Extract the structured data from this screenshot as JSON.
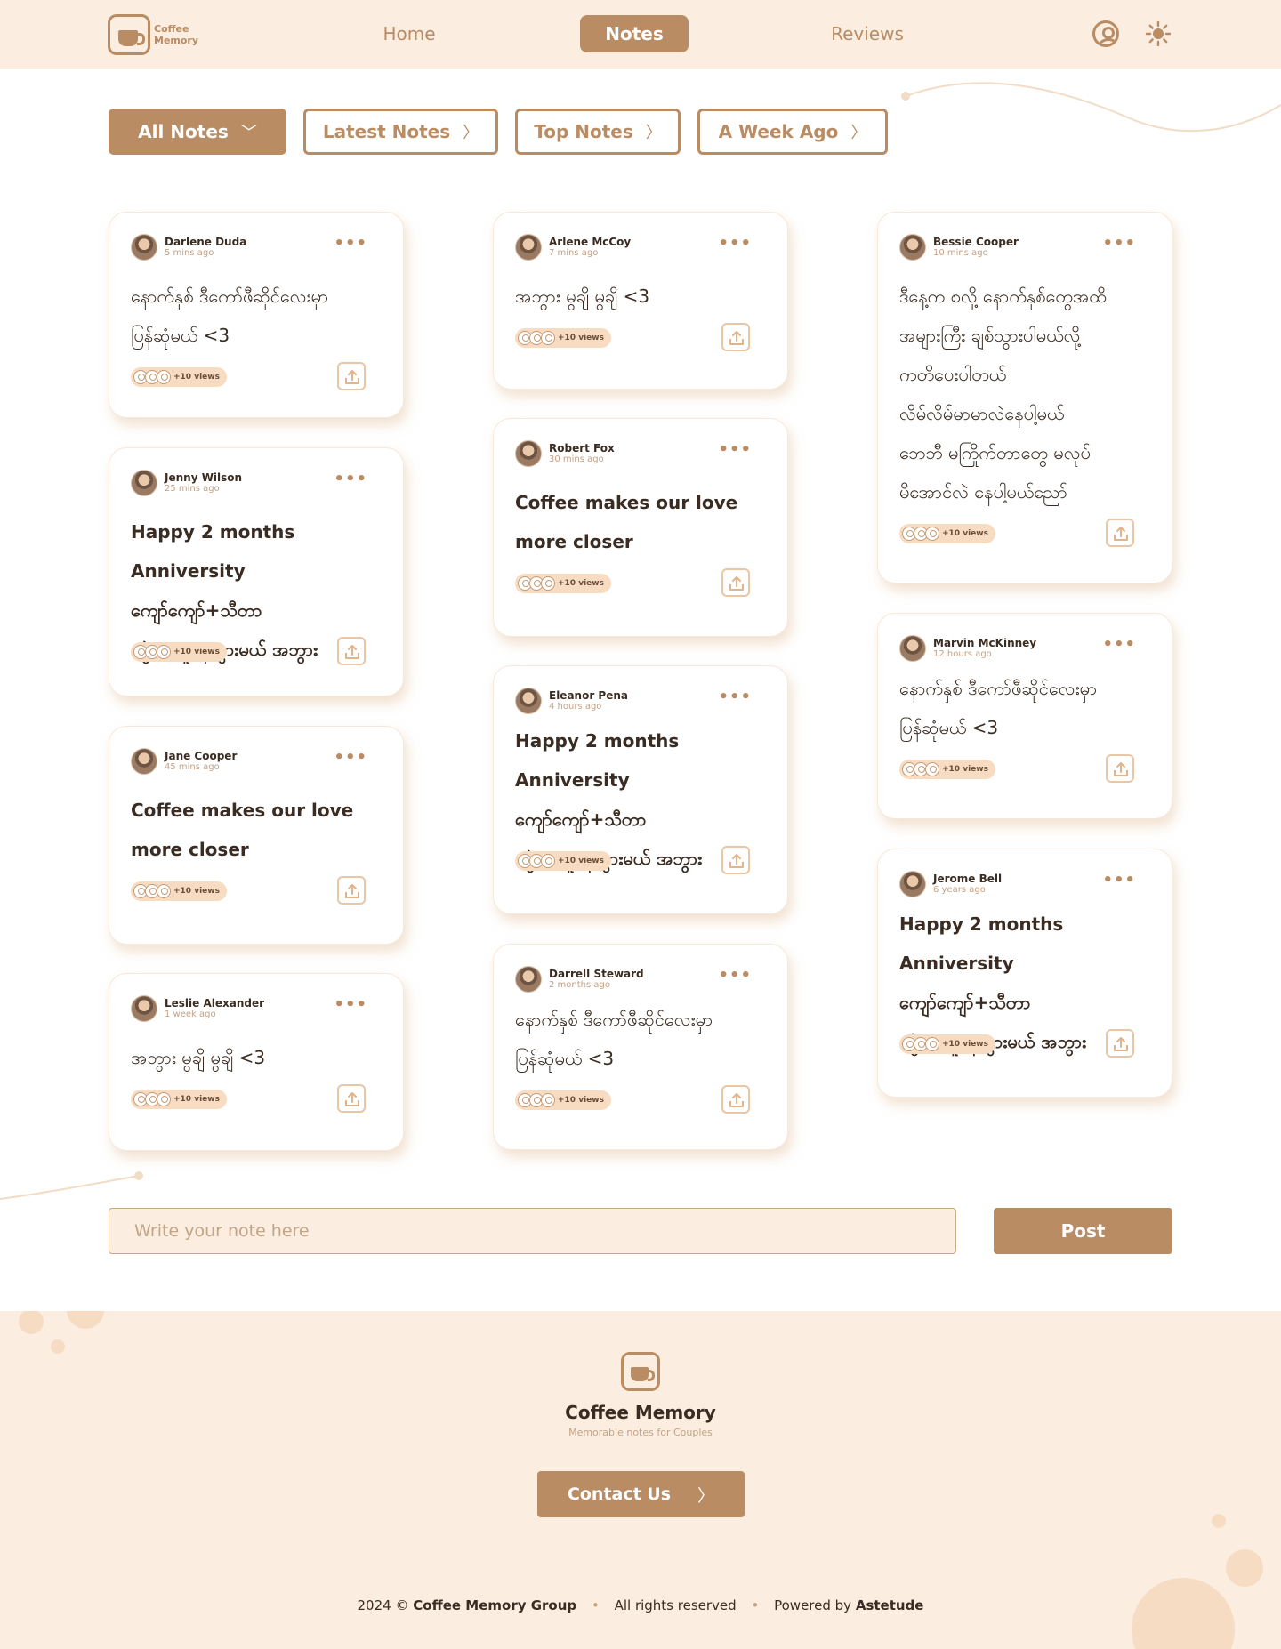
{
  "brand": {
    "logo_line1": "Coffee",
    "logo_line2": "Memory"
  },
  "nav": {
    "home": "Home",
    "notes": "Notes",
    "reviews": "Reviews"
  },
  "filters": {
    "all": "All Notes",
    "latest": "Latest Notes",
    "top": "Top Notes",
    "week": "A Week Ago"
  },
  "notes": [
    {
      "name": "Darlene Duda",
      "time": "5 mins ago",
      "lines": [
        "နောက်နှစ် ဒီကော်ဖီဆိုင်လေးမှာ",
        "ပြန်ဆုံမယ် <3"
      ],
      "views": "+10 views"
    },
    {
      "name": "Jenny Wilson",
      "time": "25 mins ago",
      "lines": [
        "Happy 2 months Anniversity",
        "ကျော်ကျော်+သီတာ",
        "မခွဲ အတူနေသွားမယ် အဘွား"
      ],
      "views": "+10 views"
    },
    {
      "name": "Jane Cooper",
      "time": "45 mins ago",
      "lines": [
        "Coffee makes our love",
        "more closer"
      ],
      "views": "+10 views"
    },
    {
      "name": "Leslie Alexander",
      "time": "1 week ago",
      "lines": [
        "အဘွား မွချိ မွချိ <3"
      ],
      "views": "+10 views"
    },
    {
      "name": "Arlene McCoy",
      "time": "7 mins ago",
      "lines": [
        "အဘွား မွချိ မွချိ <3"
      ],
      "views": "+10 views"
    },
    {
      "name": "Robert Fox",
      "time": "30 mins ago",
      "lines": [
        "Coffee makes our love",
        "more closer"
      ],
      "views": "+10 views"
    },
    {
      "name": "Eleanor Pena",
      "time": "4 hours ago",
      "lines": [
        "Happy 2 months Anniversity",
        "ကျော်ကျော်+သီတာ",
        "မခွဲ အတူနေသွားမယ် အဘွား"
      ],
      "views": "+10 views"
    },
    {
      "name": "Darrell Steward",
      "time": "2 months ago",
      "lines": [
        "နောက်နှစ် ဒီကော်ဖီဆိုင်လေးမှာ",
        "ပြန်ဆုံမယ် <3"
      ],
      "views": "+10 views"
    },
    {
      "name": "Bessie Cooper",
      "time": "10 mins ago",
      "lines": [
        "ဒီနေ့က စလို့ နောက်နှစ်တွေအထိ",
        "အများကြီး ချစ်သွားပါမယ်လို့",
        "ကတိပေးပါတယ်",
        "လိမ်လိမ်မာမာလဲနေပါ့မယ်",
        "ဘေဘီ မကြိုက်တာတွေ မလုပ်",
        "မိအောင်လဲ နေပါ့မယ်ညော်"
      ],
      "views": "+10 views"
    },
    {
      "name": "Marvin McKinney",
      "time": "12 hours ago",
      "lines": [
        "နောက်နှစ် ဒီကော်ဖီဆိုင်လေးမှာ",
        "ပြန်ဆုံမယ် <3"
      ],
      "views": "+10 views"
    },
    {
      "name": "Jerome Bell",
      "time": "6 years ago",
      "lines": [
        "Happy 2 months Anniversity",
        "ကျော်ကျော်+သီတာ",
        "မခွဲ အတူနေသွားမယ် အဘွား"
      ],
      "views": "+10 views"
    }
  ],
  "composer": {
    "placeholder": "Write your note here",
    "post": "Post"
  },
  "footer": {
    "title": "Coffee Memory",
    "subtitle": "Memorable notes for Couples",
    "contact": "Contact Us",
    "year": "2024 ©",
    "group": "Coffee Memory Group",
    "rights": "All rights reserved",
    "powered": "Powered by",
    "powered_name": "Astetude"
  },
  "colors": {
    "accent": "#b98c64",
    "cream": "#fbeddf",
    "text": "#3a2c22"
  }
}
